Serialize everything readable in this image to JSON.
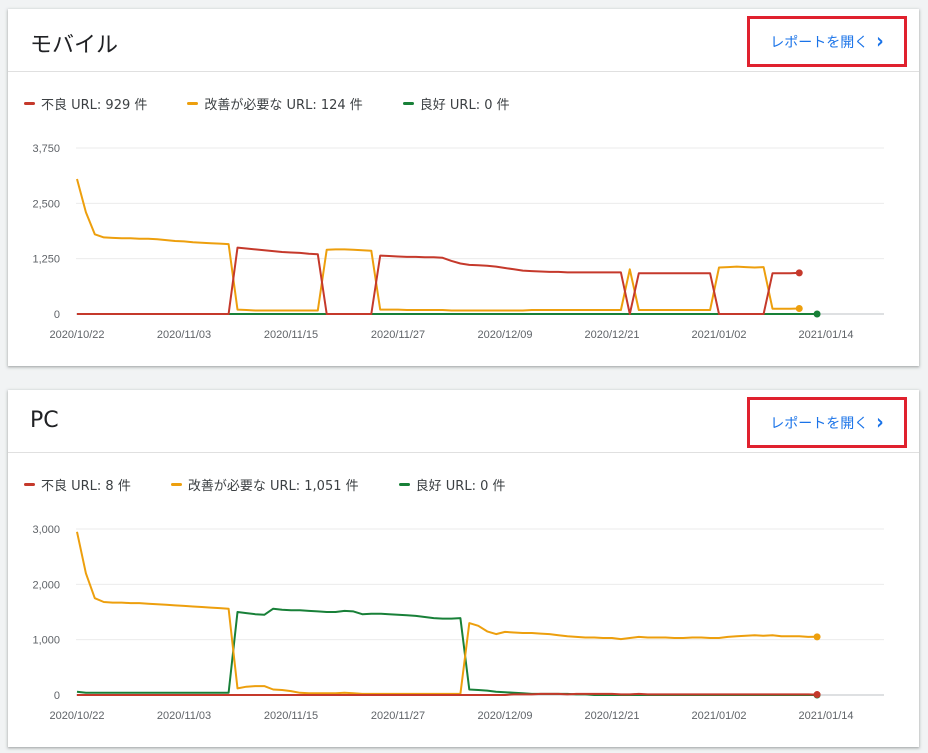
{
  "colors": {
    "bad": "#c5392b",
    "needs": "#ed9f0d",
    "good": "#188038",
    "link": "#1a73e8",
    "highlight": "#e0212e"
  },
  "cards": [
    {
      "title": "モバイル",
      "open_report_label": "レポートを開く",
      "legend": [
        "不良 URL: 929 件",
        "改善が必要な URL: 124 件",
        "良好 URL: 0 件"
      ]
    },
    {
      "title": "PC",
      "open_report_label": "レポートを開く",
      "legend": [
        "不良 URL: 8 件",
        "改善が必要な URL: 1,051 件",
        "良好 URL: 0 件"
      ]
    }
  ],
  "chart_data": [
    {
      "type": "line",
      "title": "モバイル",
      "x_tick_labels": [
        "2020/10/22",
        "2020/11/03",
        "2020/11/15",
        "2020/11/27",
        "2020/12/09",
        "2020/12/21",
        "2021/01/02",
        "2021/01/14"
      ],
      "y_tick_labels": [
        "0",
        "1,250",
        "2,500",
        "3,750"
      ],
      "ylim": [
        0,
        3750
      ],
      "x_start_date": "2020/10/22",
      "grid": true,
      "legend_position": "top-left",
      "series": [
        {
          "name": "不良 URL: 929 件",
          "color_key": "bad",
          "values": [
            0,
            0,
            0,
            0,
            0,
            0,
            0,
            0,
            0,
            0,
            0,
            0,
            0,
            0,
            0,
            0,
            0,
            0,
            1500,
            1480,
            1460,
            1440,
            1420,
            1400,
            1390,
            1380,
            1360,
            1350,
            0,
            0,
            0,
            0,
            0,
            0,
            1320,
            1310,
            1300,
            1290,
            1290,
            1280,
            1280,
            1270,
            1200,
            1140,
            1110,
            1100,
            1090,
            1070,
            1040,
            1010,
            980,
            970,
            960,
            950,
            950,
            940,
            940,
            940,
            940,
            940,
            940,
            940,
            0,
            920,
            920,
            920,
            920,
            920,
            920,
            920,
            920,
            920,
            0,
            0,
            0,
            0,
            0,
            0,
            920,
            920,
            920,
            929
          ]
        },
        {
          "name": "改善が必要な URL: 124 件",
          "color_key": "needs",
          "values": [
            3050,
            2300,
            1800,
            1730,
            1720,
            1710,
            1710,
            1700,
            1700,
            1690,
            1670,
            1650,
            1640,
            1620,
            1610,
            1600,
            1590,
            1580,
            100,
            90,
            80,
            80,
            80,
            80,
            80,
            80,
            80,
            80,
            1450,
            1460,
            1460,
            1450,
            1440,
            1430,
            100,
            100,
            100,
            90,
            90,
            90,
            90,
            90,
            80,
            80,
            80,
            80,
            80,
            80,
            80,
            80,
            80,
            90,
            90,
            90,
            90,
            90,
            90,
            90,
            90,
            90,
            90,
            90,
            1010,
            90,
            90,
            90,
            90,
            90,
            90,
            90,
            90,
            90,
            1050,
            1060,
            1070,
            1060,
            1050,
            1060,
            120,
            120,
            120,
            124
          ]
        },
        {
          "name": "良好 URL: 0 件",
          "color_key": "good",
          "values": [
            0,
            0,
            0,
            0,
            0,
            0,
            0,
            0,
            0,
            0,
            0,
            0,
            0,
            0,
            0,
            0,
            0,
            0,
            0,
            0,
            0,
            0,
            0,
            0,
            0,
            0,
            0,
            0,
            0,
            0,
            0,
            0,
            0,
            0,
            0,
            0,
            0,
            0,
            0,
            0,
            0,
            0,
            0,
            0,
            0,
            0,
            0,
            0,
            0,
            0,
            0,
            0,
            0,
            0,
            0,
            0,
            0,
            0,
            0,
            0,
            0,
            0,
            0,
            0,
            0,
            0,
            0,
            0,
            0,
            0,
            0,
            0,
            0,
            0,
            0,
            0,
            0,
            0,
            0,
            0,
            0,
            0,
            0,
            0
          ]
        }
      ]
    },
    {
      "type": "line",
      "title": "PC",
      "x_tick_labels": [
        "2020/10/22",
        "2020/11/03",
        "2020/11/15",
        "2020/11/27",
        "2020/12/09",
        "2020/12/21",
        "2021/01/02",
        "2021/01/14"
      ],
      "y_tick_labels": [
        "0",
        "1,000",
        "2,000",
        "3,000"
      ],
      "ylim": [
        0,
        3000
      ],
      "x_start_date": "2020/10/22",
      "grid": true,
      "legend_position": "top-left",
      "series": [
        {
          "name": "不良 URL: 8 件",
          "color_key": "bad",
          "values": [
            0,
            0,
            0,
            0,
            0,
            0,
            0,
            0,
            0,
            0,
            0,
            0,
            0,
            0,
            0,
            0,
            0,
            0,
            0,
            0,
            0,
            0,
            0,
            0,
            0,
            0,
            0,
            0,
            0,
            0,
            0,
            0,
            0,
            0,
            0,
            0,
            0,
            0,
            0,
            0,
            0,
            0,
            0,
            0,
            0,
            0,
            0,
            0,
            0,
            10,
            10,
            10,
            20,
            20,
            20,
            10,
            20,
            20,
            20,
            20,
            20,
            10,
            10,
            20,
            10,
            10,
            10,
            10,
            10,
            10,
            10,
            10,
            10,
            10,
            10,
            10,
            10,
            10,
            10,
            10,
            10,
            10,
            10,
            8
          ]
        },
        {
          "name": "改善が必要な URL: 1,051 件",
          "color_key": "needs",
          "values": [
            2950,
            2200,
            1750,
            1680,
            1670,
            1670,
            1660,
            1660,
            1650,
            1640,
            1630,
            1620,
            1610,
            1600,
            1590,
            1580,
            1570,
            1560,
            120,
            150,
            160,
            160,
            100,
            90,
            70,
            40,
            30,
            30,
            30,
            30,
            40,
            30,
            20,
            20,
            20,
            20,
            20,
            20,
            20,
            20,
            20,
            20,
            20,
            20,
            1300,
            1250,
            1150,
            1100,
            1140,
            1130,
            1120,
            1120,
            1110,
            1100,
            1080,
            1060,
            1050,
            1040,
            1040,
            1030,
            1030,
            1010,
            1030,
            1050,
            1040,
            1040,
            1040,
            1030,
            1030,
            1040,
            1040,
            1030,
            1030,
            1050,
            1060,
            1070,
            1080,
            1070,
            1080,
            1060,
            1060,
            1060,
            1050,
            1051
          ]
        },
        {
          "name": "良好 URL: 0 件",
          "color_key": "good",
          "values": [
            60,
            40,
            40,
            40,
            40,
            40,
            40,
            40,
            40,
            40,
            40,
            40,
            40,
            40,
            40,
            40,
            40,
            40,
            1500,
            1480,
            1460,
            1450,
            1560,
            1540,
            1530,
            1530,
            1520,
            1510,
            1500,
            1500,
            1520,
            1510,
            1460,
            1470,
            1470,
            1460,
            1450,
            1440,
            1430,
            1410,
            1390,
            1380,
            1380,
            1390,
            100,
            90,
            80,
            60,
            50,
            40,
            30,
            20,
            20,
            20,
            20,
            20,
            10,
            10,
            0,
            0,
            0,
            0,
            0,
            0,
            0,
            0,
            0,
            0,
            0,
            0,
            0,
            0,
            0,
            0,
            0,
            0,
            0,
            0,
            0,
            0,
            0,
            0,
            0,
            0
          ]
        }
      ]
    }
  ]
}
